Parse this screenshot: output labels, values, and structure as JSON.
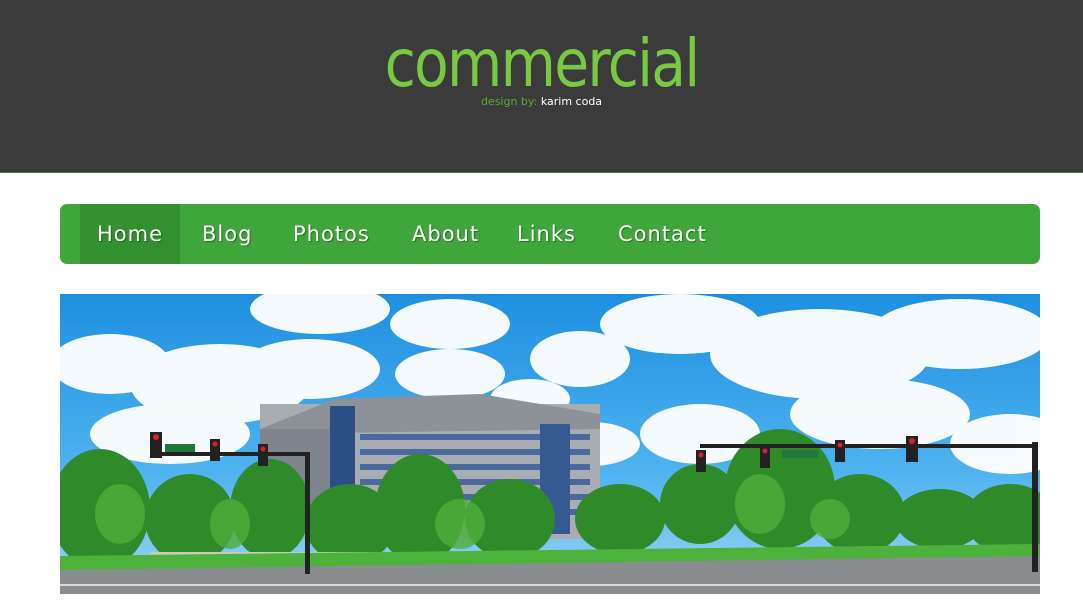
{
  "site": {
    "title": "commercial",
    "byline_prefix": "design by:",
    "byline_author": "karim coda"
  },
  "nav": {
    "items": [
      {
        "label": "Home",
        "active": true
      },
      {
        "label": "Blog",
        "active": false
      },
      {
        "label": "Photos",
        "active": false
      },
      {
        "label": "About",
        "active": false
      },
      {
        "label": "Links",
        "active": false
      },
      {
        "label": "Contact",
        "active": false
      }
    ]
  },
  "colors": {
    "header_bg": "#3b3b3b",
    "accent": "#7ac943",
    "nav_bg": "#3ea63a",
    "nav_active_bg": "#33902f"
  }
}
